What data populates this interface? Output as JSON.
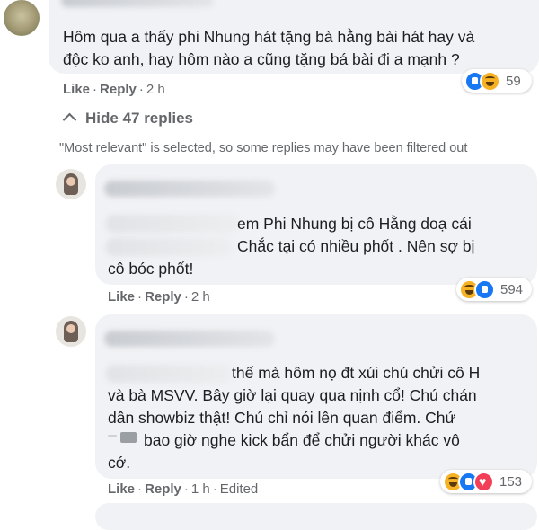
{
  "top_comment": {
    "line1": "Hôm qua a thấy phi Nhung hát tặng bà hằng bài hát hay và",
    "line2": "độc ko anh, hay hôm nào a cũng tặng bá bài đi a mạnh ?",
    "like": "Like",
    "reply": "Reply",
    "time": "2 h",
    "reaction_count": "59",
    "reactions": [
      "like-icon",
      "haha-icon"
    ]
  },
  "replies_toggle": {
    "label": "Hide 47 replies"
  },
  "filter_note": "\"Most relevant\" is selected, so some replies may have been filtered out",
  "reply1": {
    "line1": "em Phi Nhung bị cô Hằng doạ cái",
    "line2": "Chắc tại có nhiều phốt . Nên sợ bị",
    "line3": "cô bóc phốt!",
    "like": "Like",
    "reply": "Reply",
    "time": "2 h",
    "reaction_count": "594",
    "reactions": [
      "haha-icon",
      "like-icon"
    ]
  },
  "reply2": {
    "line1": "thế mà hôm nọ đt xúi chú chửi cô H",
    "line2": "và bà MSVV. Bây giờ lại quay qua nịnh cổ! Chú chán",
    "line3": "dân showbiz thật! Chú chỉ nói lên quan điểm. Chứ",
    "line4": "bao giờ nghe kick bẩn để chửi người khác vô",
    "line5": "cớ.",
    "like": "Like",
    "reply": "Reply",
    "time": "1 h",
    "edited": "Edited",
    "reaction_count": "153",
    "reactions": [
      "haha-icon",
      "like-icon",
      "love-icon"
    ]
  },
  "colors": {
    "bubble": "#f0f2f5",
    "meta_text": "#65676b",
    "like_blue": "#1877f2",
    "haha_yellow": "#f7b125",
    "love_red": "#f33e58"
  }
}
